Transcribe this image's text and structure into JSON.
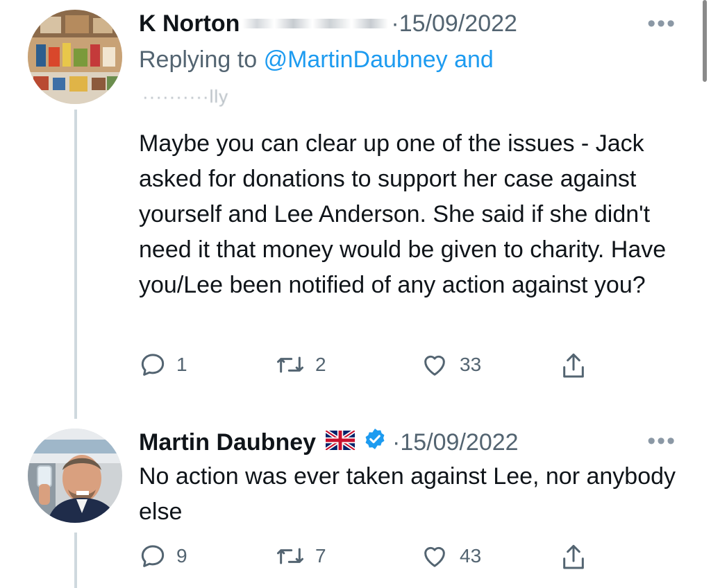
{
  "tweet1": {
    "author": "K Norton",
    "obscured_handle": "········ ·····",
    "date": "15/09/2022",
    "more": "•••",
    "reply_prefix": "Replying to",
    "reply_handle": "@MartinDaubney and",
    "blurred_line": "··········lly",
    "text": "Maybe you can clear up one of the issues - Jack asked for donations to support her case against yourself and Lee Anderson. She said if she didn't need it that money would be given to charity. Have you/Lee been notified of any action against you?",
    "reply_count": "1",
    "retweet_count": "2",
    "like_count": "33"
  },
  "tweet2": {
    "author": "Martin Daubney",
    "date": "15/09/2022",
    "more": "•••",
    "text": "No action was ever taken against Lee, nor anybody else",
    "reply_count": "9",
    "retweet_count": "7",
    "like_count": "43"
  },
  "colors": {
    "link": "#1d9bf0",
    "muted": "#536471",
    "verified": "#1d9bf0",
    "thread_line": "#cfd9de"
  },
  "icons": [
    "reply-icon",
    "retweet-icon",
    "like-icon",
    "share-icon",
    "verified-icon",
    "uk-flag-icon",
    "more-icon"
  ]
}
